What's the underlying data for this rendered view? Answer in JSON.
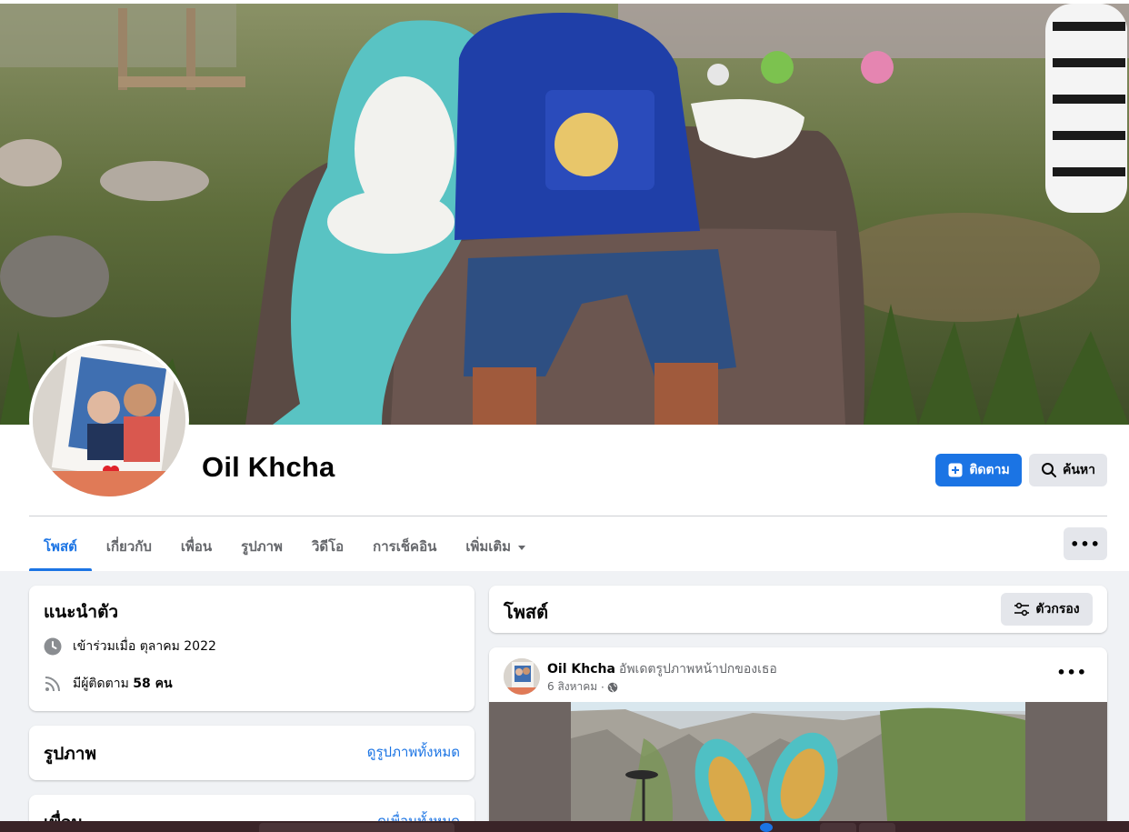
{
  "profile": {
    "name": "Oil Khcha",
    "follow_label": "ติดตาม",
    "search_label": "ค้นหา"
  },
  "tabs": [
    {
      "label": "โพสต์",
      "active": true
    },
    {
      "label": "เกี่ยวกับ",
      "active": false
    },
    {
      "label": "เพื่อน",
      "active": false
    },
    {
      "label": "รูปภาพ",
      "active": false
    },
    {
      "label": "วิดีโอ",
      "active": false
    },
    {
      "label": "การเช็คอิน",
      "active": false
    },
    {
      "label": "เพิ่มเติม",
      "active": false
    }
  ],
  "intro": {
    "title": "แนะนำตัว",
    "joined": "เข้าร่วมเมื่อ ตุลาคม 2022",
    "followers_prefix": "มีผู้ติดตาม",
    "followers_count": "58 คน"
  },
  "photos": {
    "title": "รูปภาพ",
    "see_all": "ดูรูปภาพทั้งหมด"
  },
  "friends": {
    "title": "เพื่อน",
    "see_all": "ดูเพื่อนทั้งหมด"
  },
  "posts": {
    "title": "โพสต์",
    "filter_label": "ตัวกรอง"
  },
  "post": {
    "author": "Oil Khcha",
    "action": "อัพเดตรูปภาพหน้าปกของเธอ",
    "date": "6 สิงหาคม",
    "separator": "·"
  },
  "icons": {
    "follow": "add-friend-icon",
    "search": "search-icon",
    "joined": "clock-icon",
    "followers": "rss-icon",
    "filter": "sliders-icon",
    "privacy": "globe-icon",
    "more": "more-dots-icon"
  },
  "colors": {
    "accent": "#1b74e4",
    "background": "#f0f2f5",
    "secondary_button": "#e4e6eb"
  }
}
